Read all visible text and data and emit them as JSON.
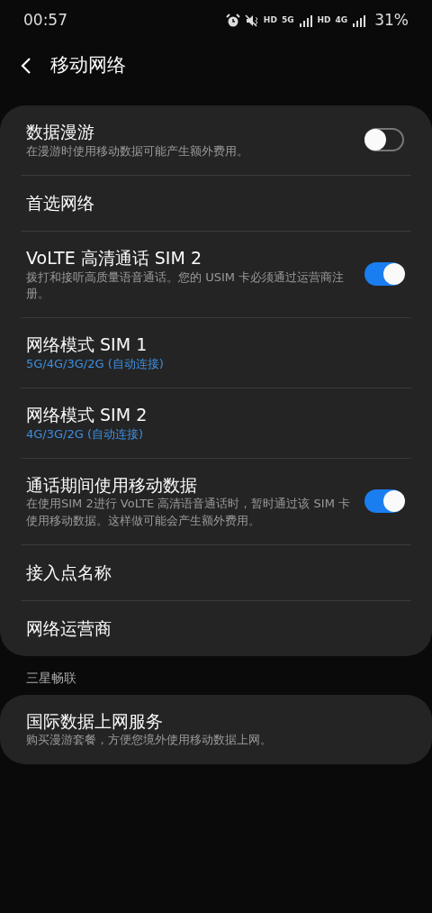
{
  "status_bar": {
    "time": "00:57",
    "indicators": [
      {
        "kind": "alarm"
      },
      {
        "kind": "mute"
      },
      {
        "kind": "label",
        "text": "HD"
      },
      {
        "kind": "network",
        "text": "5G"
      },
      {
        "kind": "signal"
      },
      {
        "kind": "label",
        "text": "HD"
      },
      {
        "kind": "network_signal",
        "text": "4G"
      }
    ],
    "battery": "31%"
  },
  "header": {
    "title": "移动网络"
  },
  "groups": [
    {
      "items": [
        {
          "kind": "switch",
          "title": "数据漫游",
          "subtitle": "在漫游时使用移动数据可能产生额外费用。",
          "on": false
        },
        {
          "kind": "plain",
          "title": "首选网络"
        },
        {
          "kind": "switch",
          "title": "VoLTE 高清通话 SIM 2",
          "subtitle": "拨打和接听高质量语音通话。您的 USIM 卡必须通过运营商注册。",
          "on": true
        },
        {
          "kind": "value",
          "title": "网络模式 SIM 1",
          "subtitle": "5G/4G/3G/2G (自动连接)"
        },
        {
          "kind": "value",
          "title": "网络模式 SIM 2",
          "subtitle": "4G/3G/2G (自动连接)"
        },
        {
          "kind": "switch",
          "title": "通话期间使用移动数据",
          "subtitle": "在使用SIM 2进行 VoLTE 高清语音通话时，暂时通过该 SIM 卡使用移动数据。这样做可能会产生额外费用。",
          "on": true
        },
        {
          "kind": "plain",
          "title": "接入点名称"
        },
        {
          "kind": "plain",
          "title": "网络运营商"
        }
      ]
    },
    {
      "heading": "三星畅联",
      "items": [
        {
          "kind": "plain",
          "title": "国际数据上网服务",
          "subtitle": "购买漫游套餐，方便您境外使用移动数据上网。"
        }
      ]
    }
  ]
}
